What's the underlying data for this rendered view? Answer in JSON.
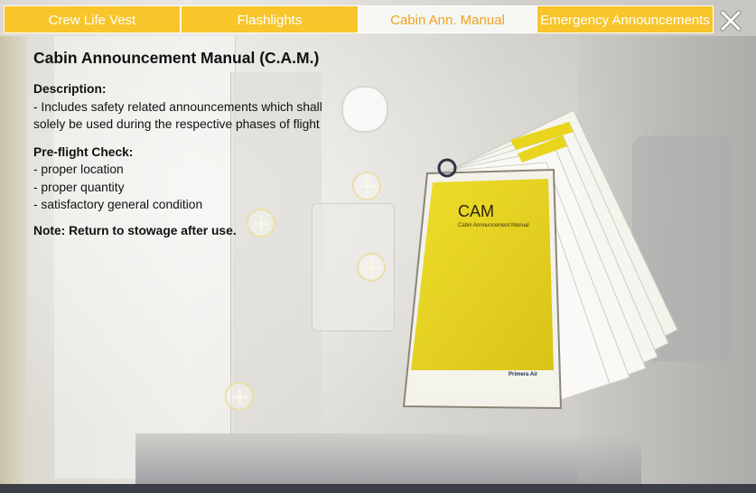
{
  "tabs": [
    {
      "label": "Crew Life Vest"
    },
    {
      "label": "Flashlights"
    },
    {
      "label": "Cabin Ann. Manual"
    },
    {
      "label": "Emergency Announcements"
    }
  ],
  "active_tab": "Cabin Ann. Manual",
  "close_icon": "close-icon",
  "content": {
    "title": "Cabin Announcement Manual (C.A.M.)",
    "description_heading": "Description:",
    "description_line1": "- Includes safety related announcements which shall",
    "description_line2": "solely be used during the respective phases of flight",
    "preflight_heading": "Pre-flight Check:",
    "preflight_items": [
      "- proper location",
      "- proper quantity",
      "- satisfactory general condition"
    ],
    "note": "Note: Return to stowage after use."
  },
  "manual_image": {
    "cover_title": "CAM",
    "cover_subtitle": "Cabin Announcement Manual",
    "brand": "Primera Air"
  },
  "colors": {
    "tab_inactive": "#f8c52a",
    "tab_active_text": "#f0a21e",
    "manual_cover": "#e8d51a"
  }
}
